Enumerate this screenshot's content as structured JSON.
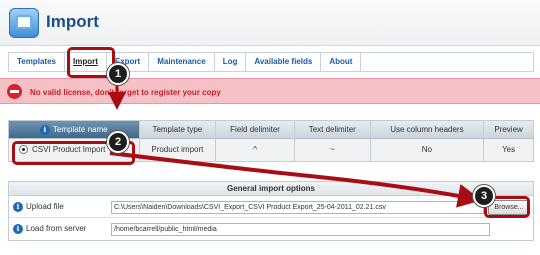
{
  "header": {
    "title": "Import"
  },
  "tabs": [
    {
      "label": "Templates"
    },
    {
      "label": "Import"
    },
    {
      "label": "Export"
    },
    {
      "label": "Maintenance"
    },
    {
      "label": "Log"
    },
    {
      "label": "Available fields"
    },
    {
      "label": "About"
    }
  ],
  "alert": {
    "text": "No valid license, don't forget to register your copy"
  },
  "template_grid": {
    "columns": [
      "Template name",
      "Template type",
      "Field delimiter",
      "Text delimiter",
      "Use column headers",
      "Preview"
    ],
    "row": {
      "name": "CSVI Product Import",
      "type": "Product import",
      "field_delimiter": "^",
      "text_delimiter": "~",
      "use_column_headers": "No",
      "preview": "Yes"
    }
  },
  "import_options": {
    "title": "General import options",
    "upload_label": "Upload file",
    "upload_value": "C:\\Users\\Naiden\\Downloads\\CSVI_Export_CSVI Product Export_25-04-2011_02.21.csv",
    "browse_label": "Browse...",
    "server_label": "Load from server",
    "server_value": "/home/bcarrell/public_html/media"
  },
  "callouts": [
    "1",
    "2",
    "3"
  ],
  "colors": {
    "highlight": "#a80d14",
    "alert_bg": "#f5c0c6",
    "alert_text": "#c71f27",
    "tab_text": "#1b5aa3"
  }
}
